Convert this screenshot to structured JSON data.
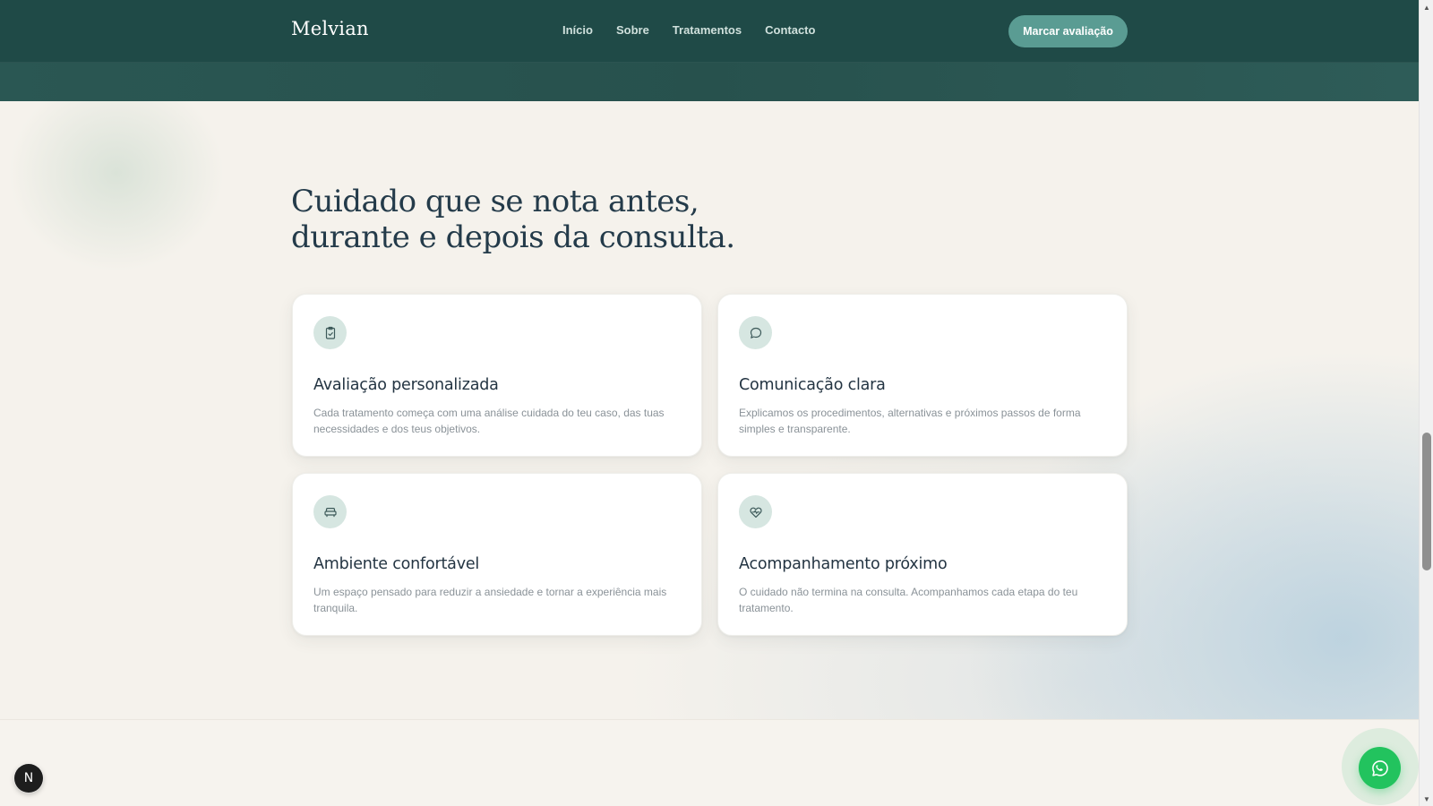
{
  "header": {
    "brand": "Melvian",
    "nav": [
      {
        "label": "Início"
      },
      {
        "label": "Sobre"
      },
      {
        "label": "Tratamentos"
      },
      {
        "label": "Contacto"
      }
    ],
    "cta_label": "Marcar avaliação"
  },
  "section": {
    "headline_line1": "Cuidado que se nota antes,",
    "headline_line2": "durante e depois da consulta.",
    "cards": [
      {
        "icon": "clipboard-check-icon",
        "title": "Avaliação personalizada",
        "description": "Cada tratamento começa com uma análise cuidada do teu caso, das tuas necessidades e dos teus objetivos."
      },
      {
        "icon": "chat-bubble-icon",
        "title": "Comunicação clara",
        "description": "Explicamos os procedimentos, alternativas e próximos passos de forma simples e transparente."
      },
      {
        "icon": "sofa-icon",
        "title": "Ambiente confortável",
        "description": "Um espaço pensado para reduzir a ansiedade e tornar a experiência mais tranquila."
      },
      {
        "icon": "heart-pulse-icon",
        "title": "Acompanhamento próximo",
        "description": "O cuidado não termina na consulta. Acompanhamos cada etapa do teu tratamento."
      }
    ]
  },
  "floating": {
    "dev_badge": "N",
    "whatsapp_icon": "whatsapp-icon"
  },
  "colors": {
    "header_bg": "#1f4a47",
    "cta_bg": "#5a9c93",
    "icon_bg": "#d6e6e1",
    "whatsapp": "#22c35e",
    "heading": "#243b4a"
  }
}
